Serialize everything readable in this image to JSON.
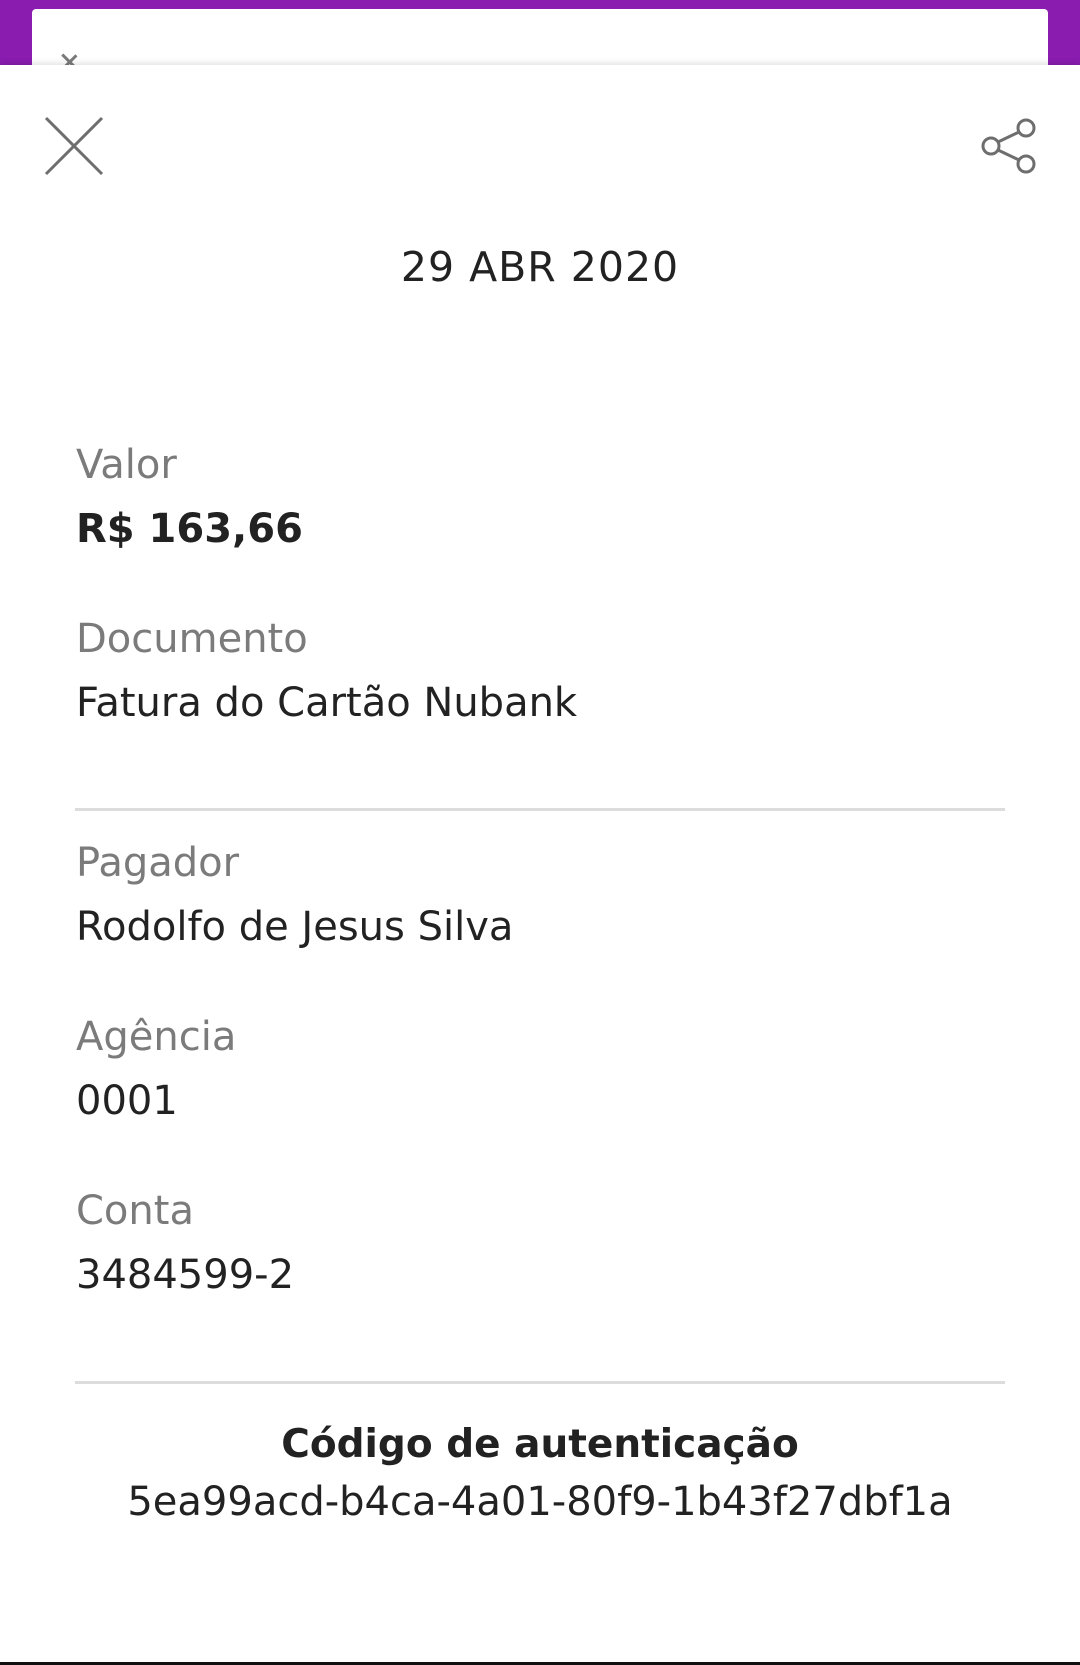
{
  "colors": {
    "brand_purple": "#8a1cb0",
    "label_gray": "#7b7b7b",
    "text_dark": "#222222",
    "divider": "#dcdcdc"
  },
  "header": {
    "close_icon": "close-icon",
    "share_icon": "share-icon"
  },
  "receipt": {
    "date": "29 ABR 2020",
    "valor_label": "Valor",
    "valor_value": "R$ 163,66",
    "documento_label": "Documento",
    "documento_value": "Fatura do Cartão Nubank",
    "pagador_label": "Pagador",
    "pagador_value": "Rodolfo de Jesus Silva",
    "agencia_label": "Agência",
    "agencia_value": "0001",
    "conta_label": "Conta",
    "conta_value": "3484599-2",
    "auth_title": "Código de autenticação",
    "auth_code": "5ea99acd-b4ca-4a01-80f9-1b43f27dbf1a"
  }
}
